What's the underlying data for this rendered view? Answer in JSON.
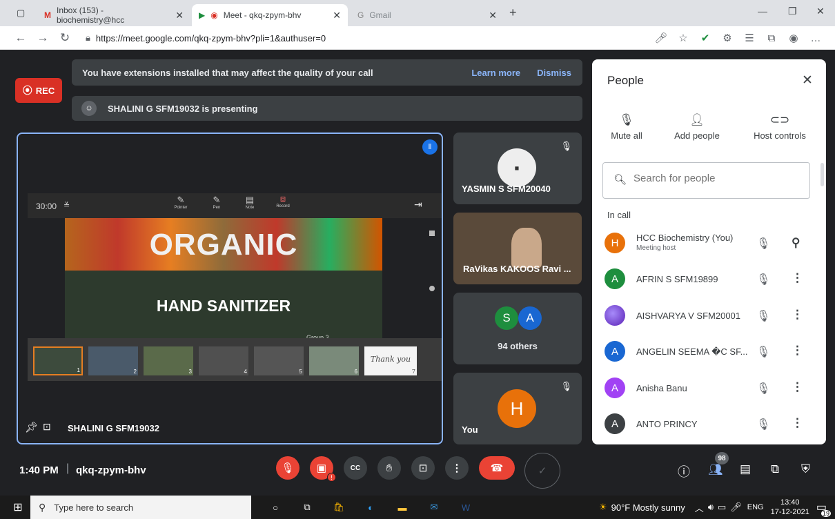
{
  "tabs": [
    {
      "label": "Inbox (153) - biochemistry@hcc"
    },
    {
      "label": "Meet - qkq-zpym-bhv"
    },
    {
      "label": "Gmail"
    }
  ],
  "address": {
    "url": "https://meet.google.com/qkq-zpym-bhv?pli=1&authuser=0"
  },
  "banner": {
    "text": "You have extensions installed that may affect the quality of your call",
    "learn_more": "Learn more",
    "dismiss": "Dismiss"
  },
  "rec": {
    "label": "REC"
  },
  "presenting": {
    "text": "SHALINI G SFM19032 is presenting"
  },
  "main": {
    "presenter": "SHALINI G SFM19032",
    "slide": {
      "timer": "30:00",
      "tools": [
        "Pointer",
        "Pen",
        "Note",
        "Record"
      ],
      "title": "ORGANIC",
      "subtitle": "HAND SANITIZER",
      "group": "Group 3",
      "thumbs": [
        {
          "n": "1"
        },
        {
          "n": "2"
        },
        {
          "n": "3"
        },
        {
          "n": "4"
        },
        {
          "n": "5"
        },
        {
          "n": "6"
        },
        {
          "n": "7"
        }
      ],
      "thank_you": "Thank you"
    }
  },
  "tiles": {
    "yasmin": {
      "name": "YASMIN S SFM20040"
    },
    "ravikas": {
      "name": "RaVikas KAKOOS Ravi ..."
    },
    "others": {
      "a1": "S",
      "a2": "A",
      "label": "94 others"
    },
    "you": {
      "avatar": "H",
      "label": "You"
    }
  },
  "people": {
    "title": "People",
    "actions": [
      {
        "label": "Mute all"
      },
      {
        "label": "Add people"
      },
      {
        "label": "Host controls"
      }
    ],
    "search_placeholder": "Search for people",
    "in_call": "In call",
    "participants": [
      {
        "initial": "H",
        "name": "HCC Biochemistry (You)",
        "sub": "Meeting host",
        "color": "#e8710a"
      },
      {
        "initial": "A",
        "name": "AFRIN S SFM19899",
        "color": "#1e8e3e"
      },
      {
        "initial": "",
        "name": "AISHVARYA V SFM20001",
        "color": "#7b61ff"
      },
      {
        "initial": "A",
        "name": "ANGELIN SEEMA �C SF...",
        "color": "#1967d2"
      },
      {
        "initial": "A",
        "name": "Anisha Banu",
        "color": "#a142f4"
      },
      {
        "initial": "A",
        "name": "ANTO PRINCY",
        "color": "#3c4043"
      }
    ]
  },
  "bottom": {
    "time": "1:40 PM",
    "meeting_code": "qkq-zpym-bhv",
    "participant_count": "98"
  },
  "taskbar": {
    "search": "Type here to search",
    "weather": "90°F  Mostly sunny",
    "lang": "ENG",
    "time": "13:40",
    "date": "17-12-2021",
    "notif": "19"
  }
}
